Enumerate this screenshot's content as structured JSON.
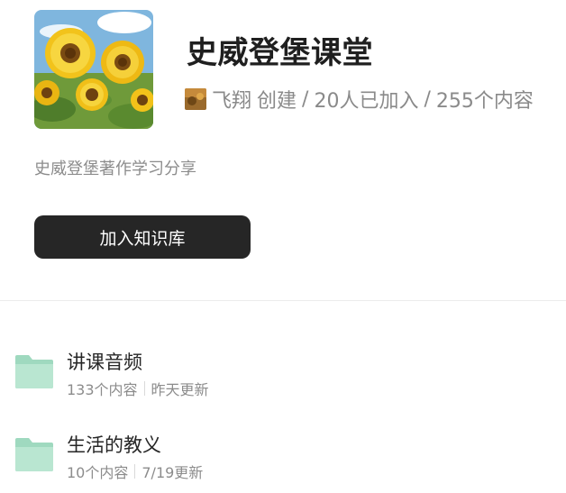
{
  "library": {
    "title": "史威登堡课堂",
    "creator": "飞翔",
    "created_label": "创建",
    "separator": "/",
    "members": "20人已加入",
    "contents": "255个内容",
    "description": "史威登堡著作学习分享",
    "join_label": "加入知识库"
  },
  "folders": [
    {
      "name": "讲课音频",
      "count": "133个内容",
      "updated": "昨天更新"
    },
    {
      "name": "生活的教义",
      "count": "10个内容",
      "updated": "7/19更新"
    }
  ],
  "colors": {
    "button_bg": "#262626",
    "folder_icon": "#b7e4cf",
    "muted_text": "#8c8c8c"
  },
  "icons": {
    "cover": "sunflower-cover-image",
    "avatar": "creator-avatar",
    "folder": "folder-icon"
  }
}
